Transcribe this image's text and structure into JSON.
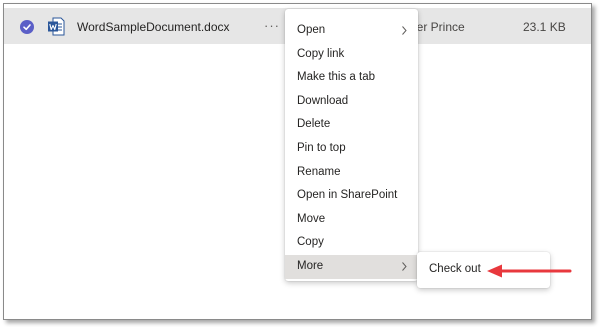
{
  "file_row": {
    "name": "WordSampleDocument.docx",
    "more_label": "···",
    "modified_by": "mber Prince",
    "size": "23.1 KB",
    "selected": true
  },
  "context_menu": {
    "items": [
      {
        "label": "Open",
        "has_submenu": true
      },
      {
        "label": "Copy link"
      },
      {
        "label": "Make this a tab"
      },
      {
        "label": "Download"
      },
      {
        "label": "Delete"
      },
      {
        "label": "Pin to top"
      },
      {
        "label": "Rename"
      },
      {
        "label": "Open in SharePoint"
      },
      {
        "label": "Move"
      },
      {
        "label": "Copy"
      },
      {
        "label": "More",
        "has_submenu": true,
        "active": true
      }
    ]
  },
  "submenu": {
    "items": [
      {
        "label": "Check out"
      }
    ]
  },
  "colors": {
    "accent": "#5b5fc7",
    "word_blue": "#2b579a",
    "row_highlight": "#e6e6e6",
    "annotation_arrow": "#e8383d"
  },
  "icons": {
    "selected": "check-circle-icon",
    "file": "word-document-icon",
    "submenu": "chevron-right-icon",
    "annotation": "arrow-left-icon"
  }
}
